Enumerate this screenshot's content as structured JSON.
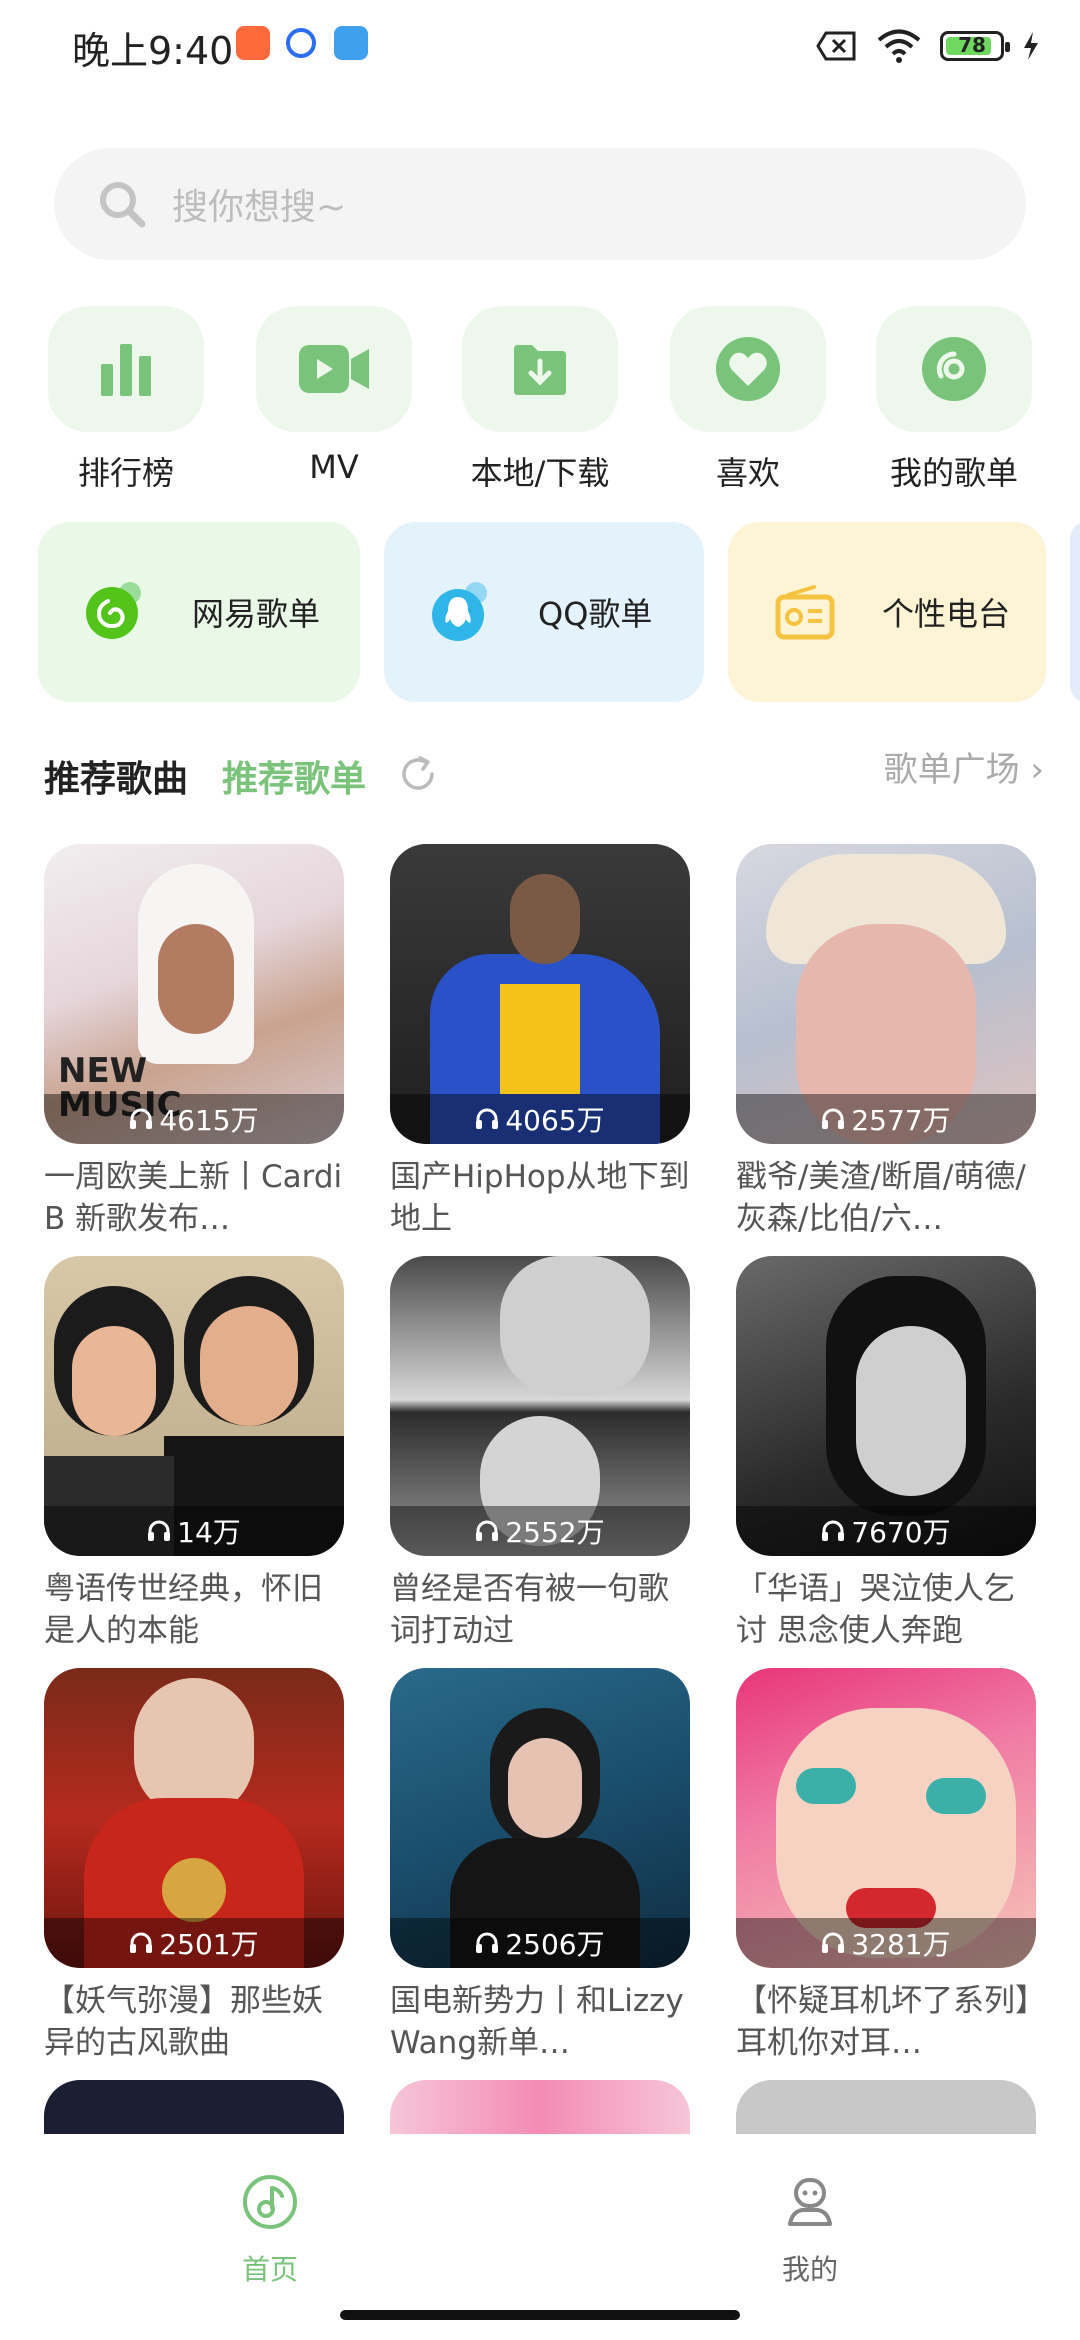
{
  "status_bar": {
    "time": "晚上9:40",
    "battery": "78"
  },
  "search": {
    "placeholder": "搜你想搜~"
  },
  "quick_actions": [
    {
      "label": "排行榜",
      "icon": "chart-bars-icon"
    },
    {
      "label": "MV",
      "icon": "video-camera-icon"
    },
    {
      "label": "本地/下载",
      "icon": "download-folder-icon"
    },
    {
      "label": "喜欢",
      "icon": "heart-icon"
    },
    {
      "label": "我的歌单",
      "icon": "disc-icon"
    }
  ],
  "sources": [
    {
      "label": "网易歌单",
      "icon": "netease-icon",
      "color": "#52c41a"
    },
    {
      "label": "QQ歌单",
      "icon": "qq-icon",
      "color": "#2fb6e8"
    },
    {
      "label": "个性电台",
      "icon": "radio-icon",
      "color": "#f5c242"
    }
  ],
  "section": {
    "tab_songs": "推荐歌曲",
    "tab_playlists": "推荐歌单",
    "square_link": "歌单广场 ›"
  },
  "playlists": [
    {
      "count": "4615万",
      "title": "一周欧美上新丨Cardi B 新歌发布…"
    },
    {
      "count": "4065万",
      "title": "国产HipHop从地下到地上"
    },
    {
      "count": "2577万",
      "title": "戳爷/美渣/断眉/萌德/灰森/比伯/六…"
    },
    {
      "count": "14万",
      "title": "粤语传世经典，怀旧是人的本能"
    },
    {
      "count": "2552万",
      "title": "曾经是否有被一句歌词打动过"
    },
    {
      "count": "7670万",
      "title": "「华语」哭泣使人乞讨 思念使人奔跑"
    },
    {
      "count": "2501万",
      "title": "【妖气弥漫】那些妖异的古风歌曲"
    },
    {
      "count": "2506万",
      "title": "国电新势力丨和Lizzy Wang新单…"
    },
    {
      "count": "3281万",
      "title": "【怀疑耳机坏了系列】耳机你对耳…"
    }
  ],
  "bottom_nav": [
    {
      "label": "首页",
      "icon": "music-note-icon",
      "active": true
    },
    {
      "label": "我的",
      "icon": "user-icon",
      "active": false
    }
  ],
  "colors": {
    "accent": "#7ac37a",
    "nav_inactive": "#666666"
  }
}
